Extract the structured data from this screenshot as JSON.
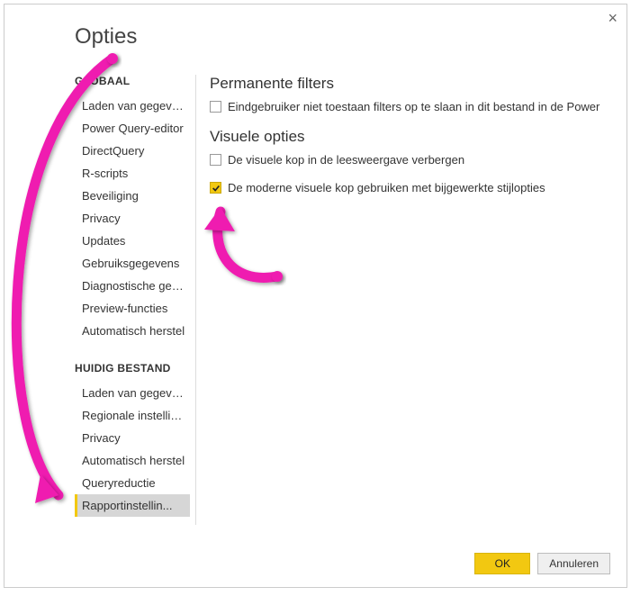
{
  "title": "Opties",
  "sidebar": {
    "group1_header": "GLOBAAL",
    "group1": [
      "Laden van gegevens",
      "Power Query-editor",
      "DirectQuery",
      "R-scripts",
      "Beveiliging",
      "Privacy",
      "Updates",
      "Gebruiksgegevens",
      "Diagnostische geg...",
      "Preview-functies",
      "Automatisch herstel"
    ],
    "group2_header": "HUIDIG BESTAND",
    "group2": [
      "Laden van gegevens",
      "Regionale instelling...",
      "Privacy",
      "Automatisch herstel",
      "Queryreductie",
      "Rapportinstellin..."
    ],
    "selected_index": 5
  },
  "content": {
    "section1_title": "Permanente filters",
    "opt1_label": "Eindgebruiker niet toestaan filters op te slaan in dit bestand in de Power",
    "opt1_checked": false,
    "section2_title": "Visuele opties",
    "opt2_label": "De visuele kop in de leesweergave verbergen",
    "opt2_checked": false,
    "opt3_label": "De moderne visuele kop gebruiken met bijgewerkte stijlopties",
    "opt3_checked": true
  },
  "footer": {
    "ok": "OK",
    "cancel": "Annuleren"
  }
}
